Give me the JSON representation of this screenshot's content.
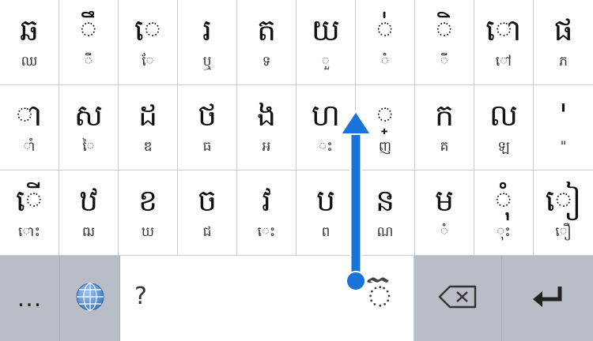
{
  "keyboard": {
    "rows": [
      [
        {
          "main": "ឆ",
          "alt": "ឈ"
        },
        {
          "main": "ឹ",
          "alt": "ឺ"
        },
        {
          "main": "េ",
          "alt": "ែ"
        },
        {
          "main": "រ",
          "alt": "ឬ"
        },
        {
          "main": "ត",
          "alt": "ទ"
        },
        {
          "main": "យ",
          "alt": "ួ"
        },
        {
          "main": "់",
          "alt": "ំ"
        },
        {
          "main": "ិ",
          "alt": "ី"
        },
        {
          "main": "ោ",
          "alt": "ៅ"
        },
        {
          "main": "ផ",
          "alt": "ភ"
        }
      ],
      [
        {
          "main": "ា",
          "alt": "ាំ"
        },
        {
          "main": "ស",
          "alt": "ៃ"
        },
        {
          "main": "ដ",
          "alt": "ឌ"
        },
        {
          "main": "ថ",
          "alt": "ធ"
        },
        {
          "main": "ង",
          "alt": "អ"
        },
        {
          "main": "ហ",
          "alt": "ះ"
        },
        {
          "main": "្",
          "alt": "ញ"
        },
        {
          "main": "ក",
          "alt": "គ"
        },
        {
          "main": "ល",
          "alt": "ឡ"
        },
        {
          "main": "'",
          "alt": "\""
        }
      ],
      [
        {
          "main": "ើ",
          "alt": "ោះ"
        },
        {
          "main": "ឋ",
          "alt": "ឍ"
        },
        {
          "main": "ខ",
          "alt": "ឃ"
        },
        {
          "main": "ច",
          "alt": "ជ"
        },
        {
          "main": "វ",
          "alt": "េះ"
        },
        {
          "main": "ប",
          "alt": "ព"
        },
        {
          "main": "ន",
          "alt": "ណ"
        },
        {
          "main": "ម",
          "alt": "ំ"
        },
        {
          "main": "ុំ",
          "alt": "ុះ"
        },
        {
          "main": "ៀ",
          "alt": "ឿ"
        }
      ]
    ],
    "bottom": {
      "more_label": "...",
      "globe_icon": "globe-icon",
      "space_hint": "?",
      "space_glyph": "៊",
      "backspace_icon": "backspace-icon",
      "enter_icon": "return-icon"
    },
    "gesture": {
      "direction": "up",
      "icon": "swipe-up-arrow-icon",
      "color": "#1a73d9"
    }
  }
}
